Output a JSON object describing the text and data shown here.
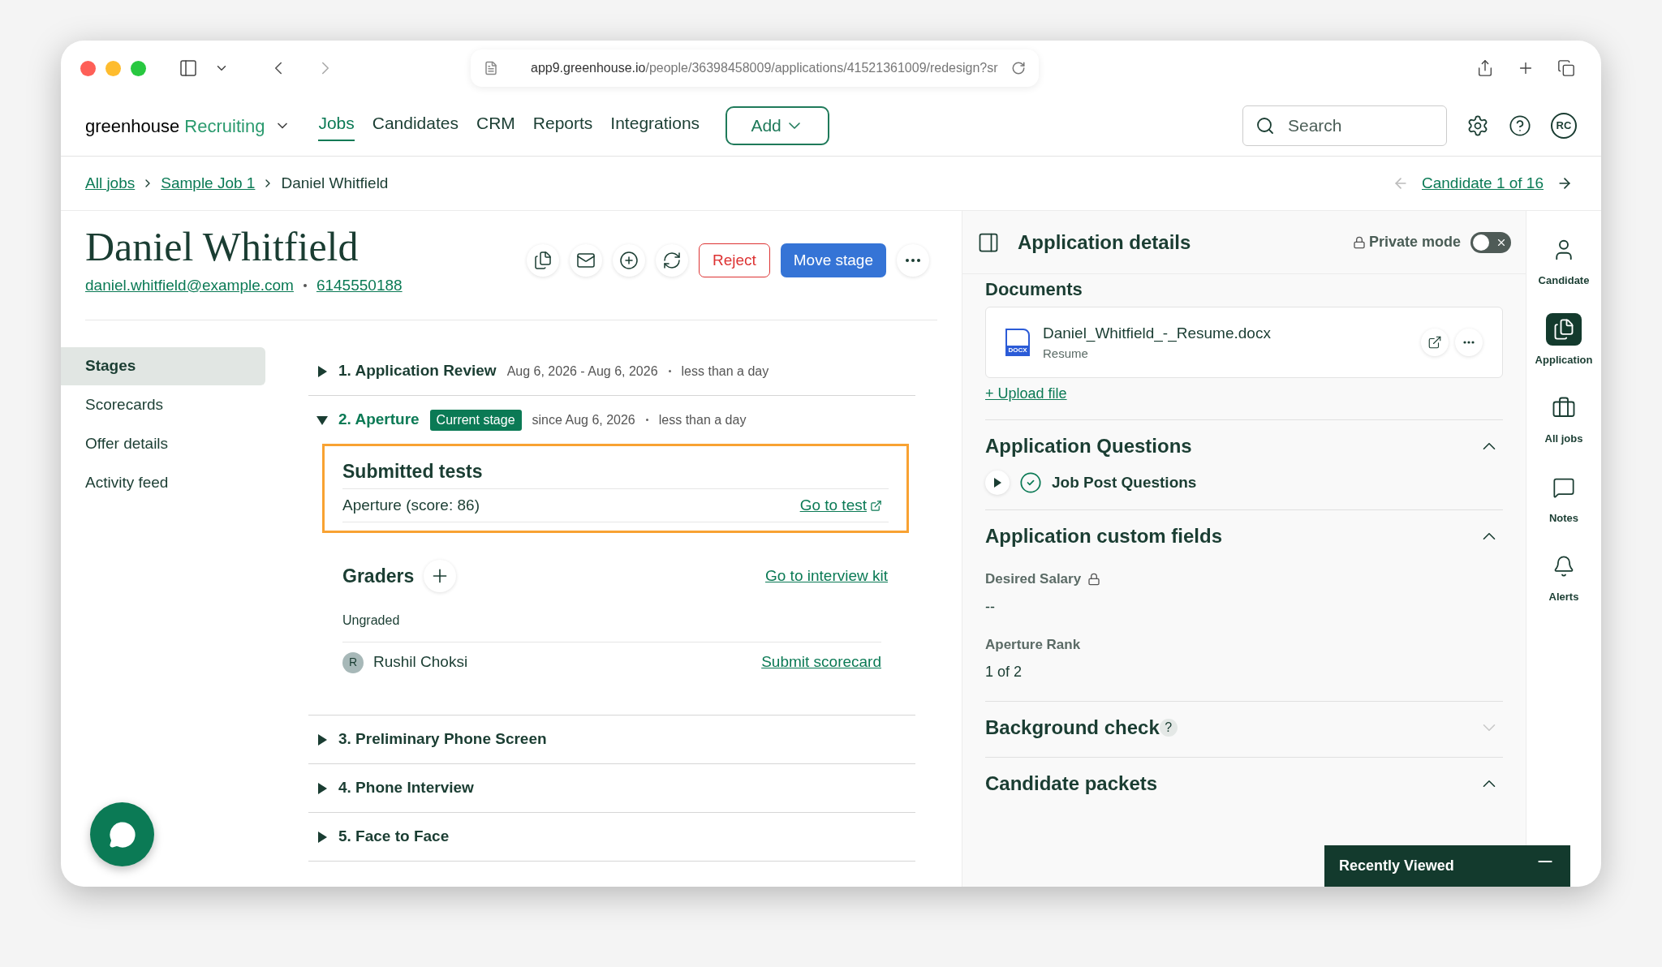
{
  "browser": {
    "url_host": "app9.greenhouse.io",
    "url_path": "/people/36398458009/applications/41521361009/redesign?sr"
  },
  "nav": {
    "brand": "greenhouse",
    "product": "Recruiting",
    "links": [
      {
        "label": "Jobs",
        "selected": true
      },
      {
        "label": "Candidates",
        "selected": false
      },
      {
        "label": "CRM",
        "selected": false
      },
      {
        "label": "Reports",
        "selected": false
      },
      {
        "label": "Integrations",
        "selected": false
      }
    ],
    "add_button": "Add",
    "search": {
      "placeholder": "Search"
    },
    "avatar": "RC"
  },
  "breadcrumb": {
    "items": [
      "All jobs",
      "Sample Job 1",
      "Daniel Whitfield"
    ],
    "pager": "Candidate 1 of 16"
  },
  "candidate": {
    "name": "Daniel Whitfield",
    "email": "daniel.whitfield@example.com",
    "phone": "6145550188",
    "reject": "Reject",
    "move_stage": "Move stage"
  },
  "side_nav": [
    {
      "label": "Stages",
      "selected": true
    },
    {
      "label": "Scorecards",
      "selected": false
    },
    {
      "label": "Offer details",
      "selected": false
    },
    {
      "label": "Activity feed",
      "selected": false
    }
  ],
  "stages": [
    {
      "title": "1. Application Review",
      "expanded": false,
      "dates": "Aug 6, 2026 - Aug 6, 2026",
      "duration": "less than a day"
    },
    {
      "title": "2. Aperture",
      "expanded": true,
      "badge": "Current stage",
      "dates": "since Aug 6, 2026",
      "duration": "less than a day",
      "details": {
        "tests_title": "Submitted tests",
        "test": "Aperture (score: 86)",
        "test_link": "Go to test",
        "graders_title": "Graders",
        "kit_link": "Go to interview kit",
        "status": "Ungraded",
        "grader": {
          "initial": "R",
          "name": "Rushil Choksi",
          "link": "Submit scorecard"
        }
      }
    },
    {
      "title": "3. Preliminary Phone Screen",
      "expanded": false
    },
    {
      "title": "4. Phone Interview",
      "expanded": false
    },
    {
      "title": "5. Face to Face",
      "expanded": false
    }
  ],
  "panel": {
    "title": "Application details",
    "private_mode": {
      "label": "Private mode",
      "on": false
    },
    "documents_title": "Documents",
    "document": {
      "name": "Daniel_Whitfield_-_Resume.docx",
      "type": "Resume",
      "badge": "DOCX"
    },
    "upload": "+ Upload file",
    "sections": [
      {
        "title": "Application Questions",
        "expanded": true,
        "kind": "questions",
        "items": [
          "Job Post Questions"
        ]
      },
      {
        "title": "Application custom fields",
        "expanded": true,
        "kind": "fields",
        "fields": [
          {
            "label": "Desired Salary",
            "locked": true,
            "value": "--"
          },
          {
            "label": "Aperture Rank",
            "locked": false,
            "value": "1 of 2"
          }
        ]
      },
      {
        "title": "Background check",
        "expanded": false,
        "kind": "help",
        "help": "?"
      },
      {
        "title": "Candidate packets",
        "expanded": true,
        "kind": "plain"
      }
    ]
  },
  "rail": [
    {
      "label": "Candidate",
      "selected": false,
      "kind": "person"
    },
    {
      "label": "Application",
      "selected": true,
      "kind": "files"
    },
    {
      "label": "All jobs",
      "selected": false,
      "kind": "briefcase"
    },
    {
      "label": "Notes",
      "selected": false,
      "kind": "notes"
    },
    {
      "label": "Alerts",
      "selected": false,
      "kind": "bell"
    }
  ],
  "recently_viewed": "Recently Viewed"
}
